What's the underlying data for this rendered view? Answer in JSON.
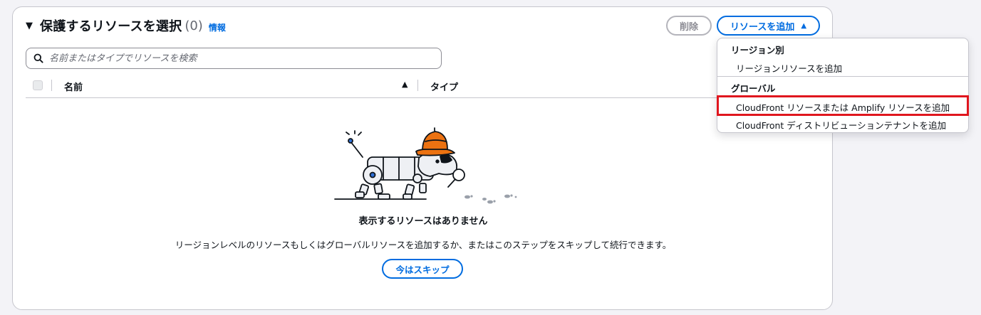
{
  "header": {
    "title": "保護するリソースを選択",
    "count": "(0)",
    "info_link": "情報",
    "delete_button": "削除",
    "add_button": "リソースを追加"
  },
  "search": {
    "placeholder": "名前またはタイプでリソースを検索"
  },
  "table": {
    "columns": [
      "名前",
      "タイプ"
    ],
    "sort_column": "名前",
    "sort_direction": "ascending"
  },
  "empty_state": {
    "title": "表示するリソースはありません",
    "description": "リージョンレベルのリソースもしくはグローバルリソースを追加するか、またはこのステップをスキップして続行できます。",
    "skip_button": "今はスキップ"
  },
  "dropdown": {
    "groups": [
      {
        "label": "リージョン別",
        "items": [
          "リージョンリソースを追加"
        ]
      },
      {
        "label": "グローバル",
        "items": [
          "CloudFront リソースまたは Amplify リソースを追加",
          "CloudFront ディストリビューションテナントを追加"
        ]
      }
    ],
    "highlighted_item": "CloudFront リソースまたは Amplify リソースを追加"
  },
  "colors": {
    "accent": "#006ce0",
    "highlight_border": "#e0161e",
    "hat": "#ec7211"
  }
}
